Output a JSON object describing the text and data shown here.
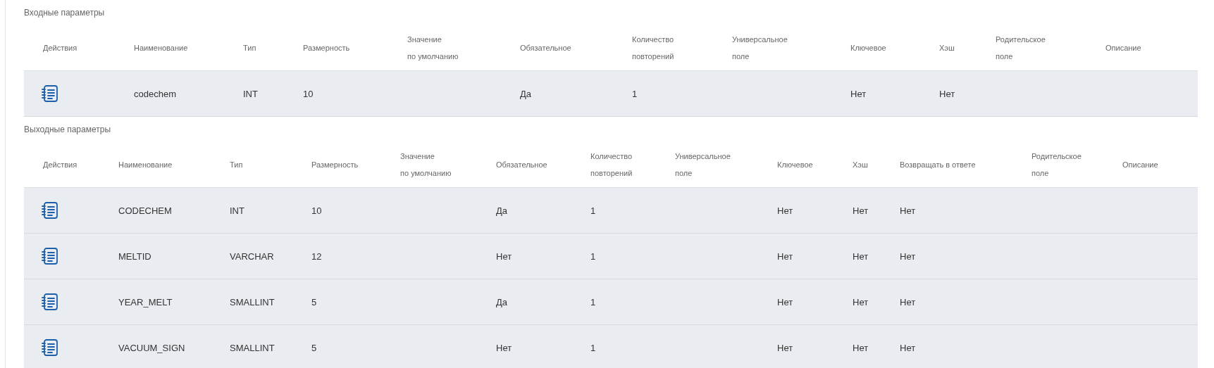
{
  "sections": [
    {
      "title": "Входные параметры",
      "columns": [
        {
          "label": "Действия",
          "kind": "actions"
        },
        {
          "label": "Наименование",
          "kind": "name"
        },
        {
          "label": "Тип",
          "kind": "type"
        },
        {
          "label": "Размерность",
          "kind": "size"
        },
        {
          "label": "Значение\nпо умолчанию",
          "kind": "default"
        },
        {
          "label": "Обязательное",
          "kind": "required"
        },
        {
          "label": "Количество\nповторений",
          "kind": "repeat"
        },
        {
          "label": "Универсальное\nполе",
          "kind": "universal"
        },
        {
          "label": "Ключевое",
          "kind": "key"
        },
        {
          "label": "Хэш",
          "kind": "hash"
        },
        {
          "label": "Родительское\nполе",
          "kind": "parent"
        },
        {
          "label": "Описание",
          "kind": "description"
        }
      ],
      "rows": [
        {
          "name": "codechem",
          "type": "INT",
          "size": "10",
          "required": "Да",
          "repeat": "1",
          "key": "Нет",
          "hash": "Нет"
        }
      ]
    },
    {
      "title": "Выходные параметры",
      "columns": [
        {
          "label": "Действия",
          "kind": "actions"
        },
        {
          "label": "Наименование",
          "kind": "name"
        },
        {
          "label": "Тип",
          "kind": "type"
        },
        {
          "label": "Размерность",
          "kind": "size"
        },
        {
          "label": "Значение\nпо умолчанию",
          "kind": "default"
        },
        {
          "label": "Обязательное",
          "kind": "required"
        },
        {
          "label": "Количество\nповторений",
          "kind": "repeat"
        },
        {
          "label": "Универсальное\nполе",
          "kind": "universal"
        },
        {
          "label": "Ключевое",
          "kind": "key"
        },
        {
          "label": "Хэш",
          "kind": "hash"
        },
        {
          "label": "Возвращать в ответе",
          "kind": "return"
        },
        {
          "label": "Родительское\nполе",
          "kind": "parent"
        },
        {
          "label": "Описание",
          "kind": "description"
        }
      ],
      "rows": [
        {
          "name": "CODECHEM",
          "type": "INT",
          "size": "10",
          "required": "Да",
          "repeat": "1",
          "key": "Нет",
          "hash": "Нет",
          "return": "Нет"
        },
        {
          "name": "MELTID",
          "type": "VARCHAR",
          "size": "12",
          "required": "Нет",
          "repeat": "1",
          "key": "Нет",
          "hash": "Нет",
          "return": "Нет"
        },
        {
          "name": "YEAR_MELT",
          "type": "SMALLINT",
          "size": "5",
          "required": "Да",
          "repeat": "1",
          "key": "Нет",
          "hash": "Нет",
          "return": "Нет"
        },
        {
          "name": "VACUUM_SIGN",
          "type": "SMALLINT",
          "size": "5",
          "required": "Нет",
          "repeat": "1",
          "key": "Нет",
          "hash": "Нет",
          "return": "Нет"
        }
      ]
    }
  ]
}
